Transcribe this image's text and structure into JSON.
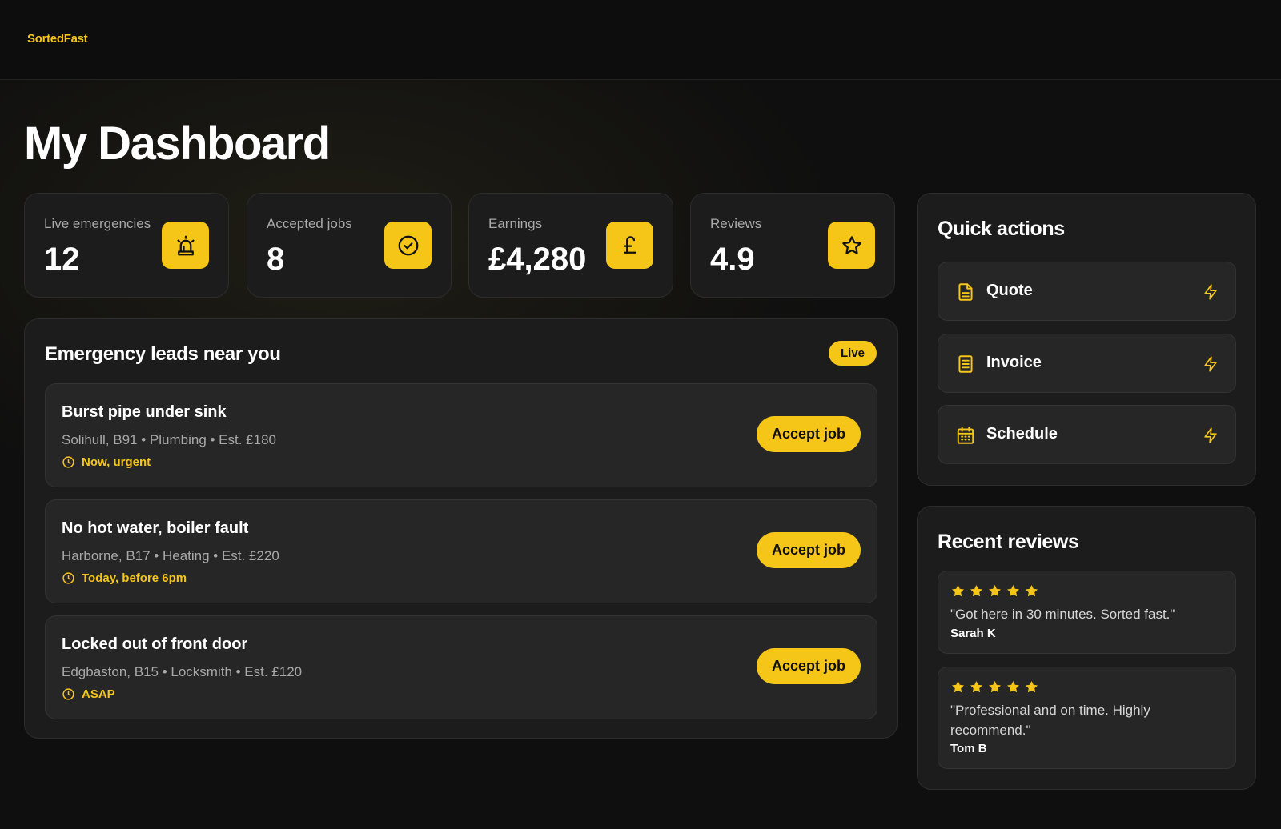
{
  "brand": {
    "name": "SortedFast",
    "accent": "#f5c518"
  },
  "page": {
    "title": "My Dashboard"
  },
  "stats": [
    {
      "label": "Live emergencies",
      "value": "12",
      "icon": "siren-icon"
    },
    {
      "label": "Accepted jobs",
      "value": "8",
      "icon": "check-circle-icon"
    },
    {
      "label": "Earnings",
      "value": "£4,280",
      "icon": "pound-icon"
    },
    {
      "label": "Reviews",
      "value": "4.9",
      "icon": "star-icon"
    }
  ],
  "leads": {
    "title": "Emergency leads near you",
    "badge": "Live",
    "items": [
      {
        "title": "Burst pipe under sink",
        "details": "Solihull, B91 • Plumbing • Est. £180",
        "urgency": "Now, urgent",
        "button": "Accept job"
      },
      {
        "title": "No hot water, boiler fault",
        "details": "Harborne, B17 • Heating • Est. £220",
        "urgency": "Today, before 6pm",
        "button": "Accept job"
      },
      {
        "title": "Locked out of front door",
        "details": "Edgbaston, B15 • Locksmith • Est. £120",
        "urgency": "ASAP",
        "button": "Accept job"
      }
    ]
  },
  "quick_actions": {
    "title": "Quick actions",
    "items": [
      {
        "label": "Quote",
        "icon": "document-icon"
      },
      {
        "label": "Invoice",
        "icon": "receipt-icon"
      },
      {
        "label": "Schedule",
        "icon": "calendar-icon"
      }
    ]
  },
  "reviews": {
    "title": "Recent reviews",
    "items": [
      {
        "rating": 5,
        "text": "\"Got here in 30 minutes. Sorted fast.\"",
        "author": "Sarah K"
      },
      {
        "rating": 5,
        "text": "\"Professional and on time. Highly recommend.\"",
        "author": "Tom B"
      }
    ]
  }
}
